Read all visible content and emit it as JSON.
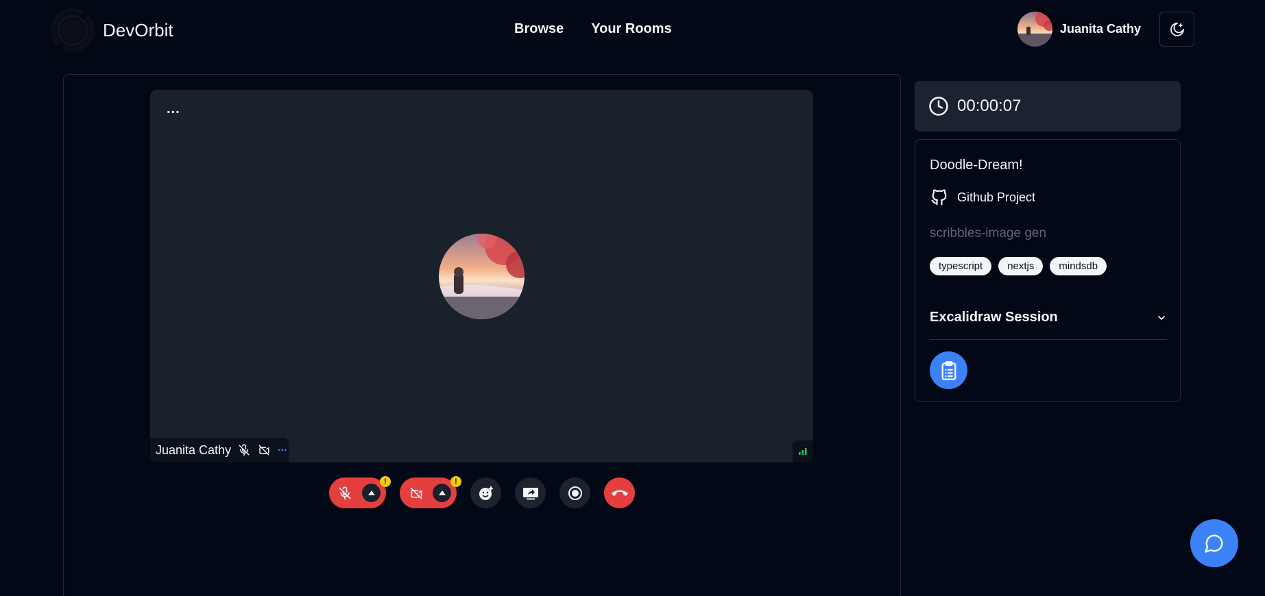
{
  "header": {
    "brand": "DevOrbit",
    "nav": [
      {
        "label": "Browse"
      },
      {
        "label": "Your Rooms"
      }
    ],
    "user_name": "Juanita Cathy",
    "theme_icon": "moon-stars-icon"
  },
  "video": {
    "menu_label": "...",
    "participant_name": "Juanita Cathy",
    "tag_more_label": "...",
    "icons": [
      "mic-off-icon",
      "video-off-icon",
      "signal-icon"
    ]
  },
  "controls": {
    "warning_mark": "!",
    "icons": [
      "mic-off-icon",
      "video-off-icon",
      "emoji-add-icon",
      "screen-share-icon",
      "record-icon",
      "hang-up-icon"
    ]
  },
  "timer": {
    "value": "00:00:07",
    "icon": "clock-icon"
  },
  "room": {
    "name": "Doodle-Dream!",
    "github_label": "Github Project",
    "description": "scribbles-image gen",
    "tags": [
      "typescript",
      "nextjs",
      "mindsdb"
    ],
    "section_title": "Excalidraw Session",
    "section_icon": "chevron-down-icon",
    "action_icon": "clipboard-icon"
  },
  "chat_icon": "chat-bubble-icon",
  "colors": {
    "background": "#030817",
    "tile": "#19212b",
    "accent_blue": "#3b82f6",
    "danger_red": "#e53e3e",
    "warning_yellow": "#f6c90e"
  }
}
